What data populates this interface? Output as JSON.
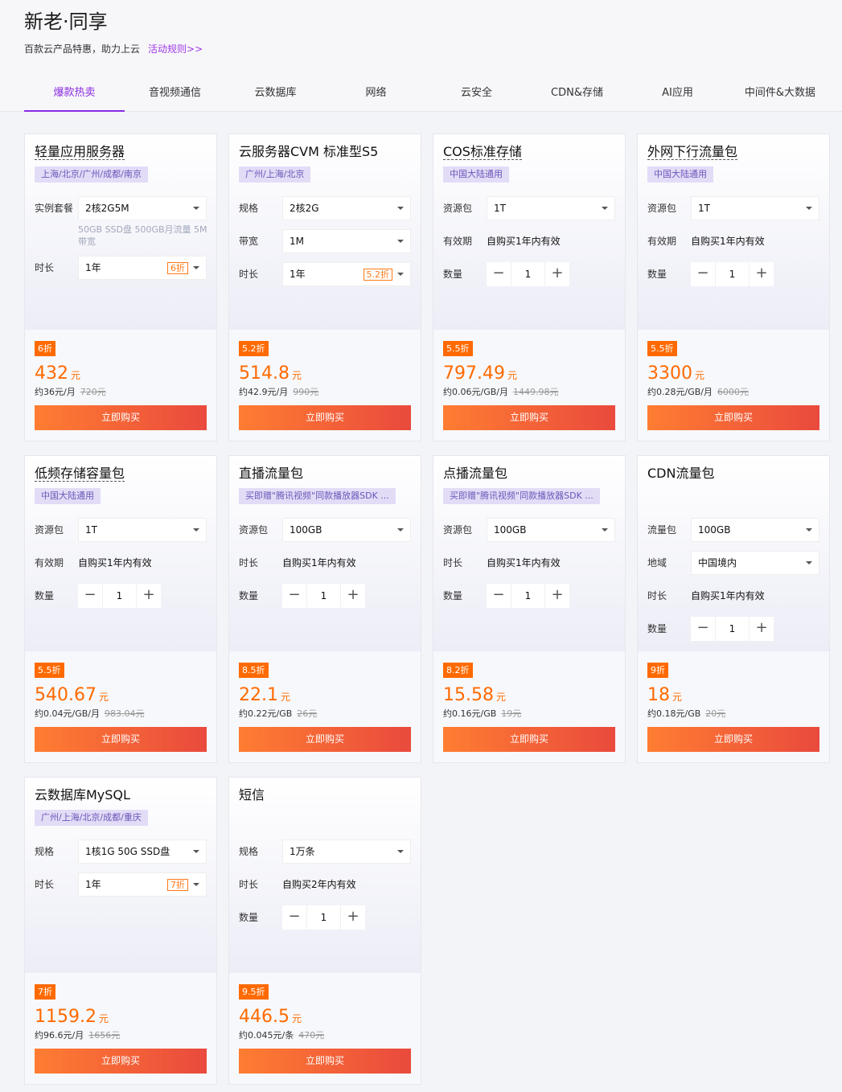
{
  "header": {
    "title": "新老·同享",
    "subtitle": "百款云产品特惠，助力上云",
    "rules_link": "活动规则>>"
  },
  "tabs": [
    {
      "label": "爆款热卖",
      "active": true
    },
    {
      "label": "音视频通信"
    },
    {
      "label": "云数据库"
    },
    {
      "label": "网络"
    },
    {
      "label": "云安全"
    },
    {
      "label": "CDN&存储"
    },
    {
      "label": "AI应用"
    },
    {
      "label": "中间件&大数据"
    }
  ],
  "buy_label": "立即购买",
  "stepper": {
    "minus": "−",
    "plus": "+"
  },
  "cards": [
    {
      "name": "轻量应用服务器",
      "region": "上海/北京/广州/成都/南京",
      "rows": [
        {
          "label": "实例套餐",
          "value": "2核2G5M",
          "note": "50GB SSD盘 500GB月流量 5M带宽"
        },
        {
          "label": "时长",
          "value": "1年",
          "tag": "6折"
        }
      ],
      "badge": "6折",
      "price": "432",
      "unit": "元",
      "per": "约36元/月",
      "original": "720元"
    },
    {
      "name": "云服务器CVM 标准型S5",
      "region": "广州/上海/北京",
      "rows": [
        {
          "label": "规格",
          "value": "2核2G"
        },
        {
          "label": "带宽",
          "value": "1M"
        },
        {
          "label": "时长",
          "value": "1年",
          "tag": "5.2折"
        }
      ],
      "badge": "5.2折",
      "price": "514.8",
      "unit": "元",
      "per": "约42.9元/月",
      "original": "990元"
    },
    {
      "name": "COS标准存储",
      "region": "中国大陆通用",
      "rows": [
        {
          "label": "资源包",
          "value": "1T"
        },
        {
          "label": "有效期",
          "text": "自购买1年内有效"
        },
        {
          "label": "数量",
          "qty": "1"
        }
      ],
      "badge": "5.5折",
      "price": "797.49",
      "unit": "元",
      "per": "约0.06元/GB/月",
      "original": "1449.98元"
    },
    {
      "name": "外网下行流量包",
      "region": "中国大陆通用",
      "rows": [
        {
          "label": "资源包",
          "value": "1T"
        },
        {
          "label": "有效期",
          "text": "自购买1年内有效"
        },
        {
          "label": "数量",
          "qty": "1"
        }
      ],
      "badge": "5.5折",
      "price": "3300",
      "unit": "元",
      "per": "约0.28元/GB/月",
      "original": "6000元"
    },
    {
      "name": "低频存储容量包",
      "region": "中国大陆通用",
      "rows": [
        {
          "label": "资源包",
          "value": "1T"
        },
        {
          "label": "有效期",
          "text": "自购买1年内有效"
        },
        {
          "label": "数量",
          "qty": "1"
        }
      ],
      "badge": "5.5折",
      "price": "540.67",
      "unit": "元",
      "per": "约0.04元/GB/月",
      "original": "983.04元"
    },
    {
      "name": "直播流量包",
      "region": "买即赠\"腾讯视频\"同款播放器SDK ...",
      "rows": [
        {
          "label": "资源包",
          "value": "100GB"
        },
        {
          "label": "时长",
          "text": "自购买1年内有效"
        },
        {
          "label": "数量",
          "qty": "1"
        }
      ],
      "badge": "8.5折",
      "price": "22.1",
      "unit": "元",
      "per": "约0.22元/GB",
      "original": "26元"
    },
    {
      "name": "点播流量包",
      "region": "买即赠\"腾讯视频\"同款播放器SDK ...",
      "rows": [
        {
          "label": "资源包",
          "value": "100GB"
        },
        {
          "label": "时长",
          "text": "自购买1年内有效"
        },
        {
          "label": "数量",
          "qty": "1"
        }
      ],
      "badge": "8.2折",
      "price": "15.58",
      "unit": "元",
      "per": "约0.16元/GB",
      "original": "19元"
    },
    {
      "name": "CDN流量包",
      "region": "",
      "rows": [
        {
          "label": "流量包",
          "value": "100GB"
        },
        {
          "label": "地域",
          "value": "中国境内"
        },
        {
          "label": "时长",
          "text": "自购买1年内有效"
        },
        {
          "label": "数量",
          "qty": "1"
        }
      ],
      "badge": "9折",
      "price": "18",
      "unit": "元",
      "per": "约0.18元/GB",
      "original": "20元"
    },
    {
      "name": "云数据库MySQL",
      "region": "广州/上海/北京/成都/重庆",
      "rows": [
        {
          "label": "规格",
          "value": "1核1G 50G SSD盘"
        },
        {
          "label": "时长",
          "value": "1年",
          "tag": "7折"
        }
      ],
      "badge": "7折",
      "price": "1159.2",
      "unit": "元",
      "per": "约96.6元/月",
      "original": "1656元"
    },
    {
      "name": "短信",
      "region": "",
      "rows": [
        {
          "label": "规格",
          "value": "1万条"
        },
        {
          "label": "时长",
          "text": "自购买2年内有效"
        },
        {
          "label": "数量",
          "qty": "1"
        }
      ],
      "badge": "9.5折",
      "price": "446.5",
      "unit": "元",
      "per": "约0.045元/条",
      "original": "470元"
    }
  ]
}
